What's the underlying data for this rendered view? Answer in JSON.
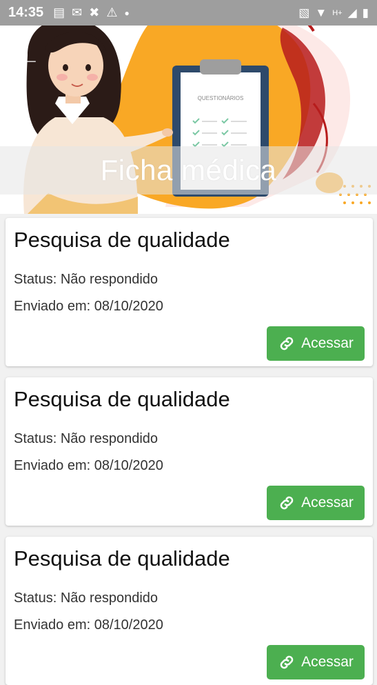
{
  "status_bar": {
    "time": "14:35",
    "icons_left": [
      "message-icon",
      "mail-icon",
      "missed-call-icon",
      "warning-icon",
      "dot-icon"
    ],
    "icons_right": [
      "vibrate-icon",
      "wifi-icon",
      "signal-icon",
      "battery-icon"
    ],
    "network_label": "H+"
  },
  "header": {
    "title": "Ficha médica",
    "clipboard_label": "QUESTIONÁRIOS"
  },
  "cards": [
    {
      "title": "Pesquisa de qualidade",
      "status": "Status: Não respondido",
      "sent": "Enviado em: 08/10/2020",
      "button": "Acessar"
    },
    {
      "title": "Pesquisa de qualidade",
      "status": "Status: Não respondido",
      "sent": "Enviado em: 08/10/2020",
      "button": "Acessar"
    },
    {
      "title": "Pesquisa de qualidade",
      "status": "Status: Não respondido",
      "sent": "Enviado em: 08/10/2020",
      "button": "Acessar"
    }
  ],
  "colors": {
    "accent": "#4caf50",
    "blob": "#f9a825",
    "dark_blob": "#b71c1c"
  }
}
